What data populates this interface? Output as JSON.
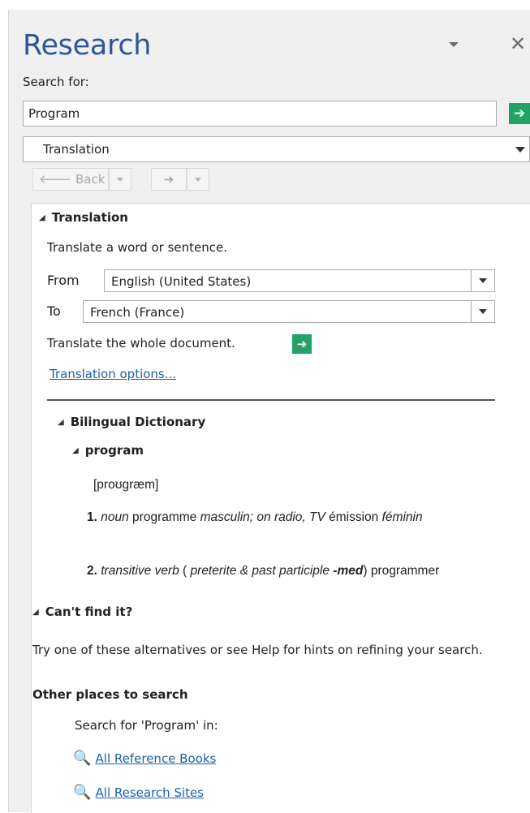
{
  "pane": {
    "title": "Research",
    "search_label": "Search for:",
    "search_value": "Program",
    "service": "Translation",
    "nav": {
      "back": "Back"
    }
  },
  "translation": {
    "heading": "Translation",
    "hint": "Translate a word or sentence.",
    "from_label": "From",
    "from_value": "English (United States)",
    "to_label": "To",
    "to_value": "French (France)",
    "whole_doc": "Translate the whole document.",
    "options_link": "Translation options..."
  },
  "dictionary": {
    "heading": "Bilingual Dictionary",
    "entry": "program",
    "pronunciation": "[proʊgræm]",
    "sense1": {
      "num": "1.",
      "pos": "noun",
      "text1": "programme",
      "gender1": "masculin",
      "context": "; on radio, TV",
      "text2": "émission",
      "gender2": "féminin"
    },
    "sense2": {
      "num": "2.",
      "pos": "transitive verb",
      "open": "(",
      "note": "preterite & past participle",
      "suffix": "-med",
      "close": ")",
      "translation": "programmer"
    }
  },
  "cantfind": {
    "heading": "Can't find it?",
    "advice": "Try one of these alternatives or see Help for hints on refining your search.",
    "other_places": "Other places to search",
    "search_in": "Search for 'Program' in:",
    "links": [
      "All Reference Books",
      "All Research Sites"
    ]
  },
  "colors": {
    "title": "#2b579a",
    "go": "#21a366",
    "link": "#1f5fa8"
  }
}
